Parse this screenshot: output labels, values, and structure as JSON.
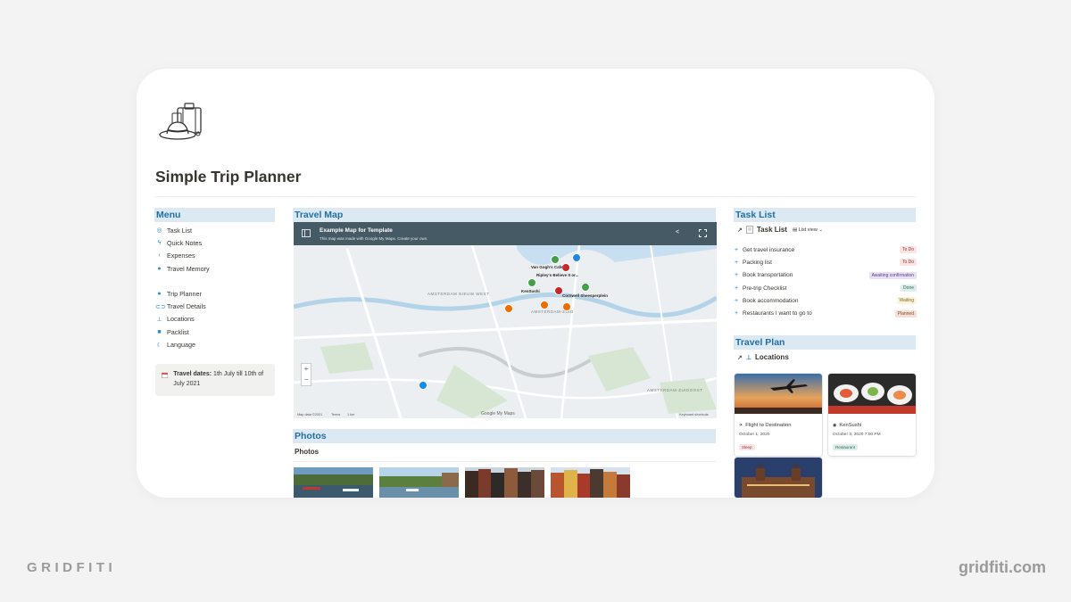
{
  "page": {
    "title": "Simple Trip Planner"
  },
  "menu": {
    "heading": "Menu",
    "items": [
      {
        "label": "Task List",
        "icon": "check-circle-icon"
      },
      {
        "label": "Quick Notes",
        "icon": "lightning-icon"
      },
      {
        "label": "Expenses",
        "icon": "chevron-left-icon"
      },
      {
        "label": "Travel Memory",
        "icon": "globe-icon"
      },
      {
        "label": "Trip Planner",
        "icon": "pin-icon"
      },
      {
        "label": "Travel Details",
        "icon": "link-icon"
      },
      {
        "label": "Locations",
        "icon": "pushpin-icon"
      },
      {
        "label": "Packlist",
        "icon": "suitcase-icon"
      },
      {
        "label": "Language",
        "icon": "moon-icon"
      }
    ],
    "callout": {
      "bold": "Travel dates:",
      "text": " 1th July till 10th of July 2021"
    }
  },
  "travel_map": {
    "heading": "Travel Map",
    "title": "Example Map for Template",
    "subtitle": "This map was made with Google My Maps. Create your own.",
    "area_labels": [
      "AMSTERDAM NIEUW WEST",
      "AMSTERDAM-ZUID",
      "AMSTERDAM-ZUIDOOST"
    ],
    "places": [
      "Van Gogh's Cafe",
      "Ripley's Believe It or...",
      "KenSushi",
      "Cornwell Sheesperplein"
    ],
    "footer": [
      "Map data ©2021",
      "Terms",
      "1 km",
      "Keyboard shortcuts"
    ],
    "google_label": "Google My Maps"
  },
  "photos": {
    "heading": "Photos",
    "subheading": "Photos"
  },
  "task_list": {
    "heading": "Task List",
    "link_title": "Task List",
    "view": "List view",
    "tasks": [
      {
        "name": "Get travel insurance",
        "status": "To Do"
      },
      {
        "name": "Packing list",
        "status": "To Do"
      },
      {
        "name": "Book transportation",
        "status": "Awaiting confirmation"
      },
      {
        "name": "Pre-trip Checklist",
        "status": "Done"
      },
      {
        "name": "Book accommodation",
        "status": "Waiting"
      },
      {
        "name": "Restaurants I want to go to",
        "status": "Planned"
      }
    ]
  },
  "travel_plan": {
    "heading": "Travel Plan",
    "link_title": "Locations",
    "cards": [
      {
        "name": "Flight to Destination",
        "date": "October 1, 2020",
        "tag": "Sleep"
      },
      {
        "name": "KenSushi",
        "date": "October 3, 2020 7:00 PM",
        "tag": "Restaurant"
      }
    ]
  },
  "brand": {
    "left": "GRIDFITI",
    "right": "gridfiti.com"
  },
  "colors": {
    "heading_bg": "#dde9f2",
    "heading_text": "#1f6fa6",
    "map_header": "#455a64",
    "tag_todo": "#fbe4e4",
    "tag_awaiting": "#e9e0f5",
    "tag_done": "#ddedea",
    "tag_waiting": "#fbf3db",
    "tag_planned": "#f4dfd6"
  }
}
